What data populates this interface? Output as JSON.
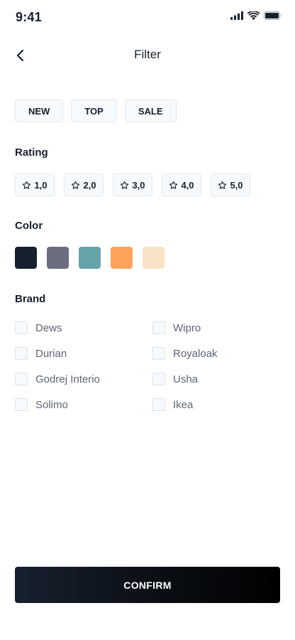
{
  "status": {
    "time": "9:41",
    "icons": [
      "signal-icon",
      "wifi-icon",
      "battery-icon"
    ]
  },
  "header": {
    "title": "Filter",
    "back_icon": "chevron-left-icon"
  },
  "tags": [
    "NEW",
    "TOP",
    "SALE"
  ],
  "rating": {
    "title": "Rating",
    "options": [
      "1,0",
      "2,0",
      "3,0",
      "4,0",
      "5,0"
    ],
    "icon": "star-outline-icon"
  },
  "color": {
    "title": "Color",
    "swatches": [
      "#17202e",
      "#6b6e7f",
      "#66a3a8",
      "#ffa35c",
      "#f9e3c7"
    ]
  },
  "brand": {
    "title": "Brand",
    "items": [
      "Dews",
      "Wipro",
      "Durian",
      "Royaloak",
      "Godrej Interio",
      "Usha",
      "Solimo",
      "Ikea"
    ]
  },
  "confirm": {
    "label": "CONFIRM"
  },
  "colors": {
    "primary": "#17202e",
    "text_secondary": "#5b6577",
    "chip_bg": "#f7fafc",
    "chip_border": "#e2e8f0"
  }
}
